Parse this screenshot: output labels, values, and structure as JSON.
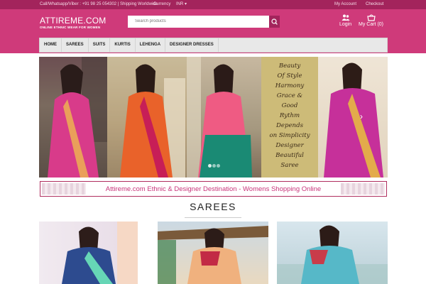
{
  "topbar": {
    "contact": "Call/Whatsapp/Viber : +91 98 25 054302 | Shipping Worldwide",
    "currency_label": "Currency",
    "currency_value": "INR",
    "my_account": "My Account",
    "checkout": "Checkout"
  },
  "header": {
    "logo_name": "ATTIREME.COM",
    "logo_tagline": "ONLINE ETHNIC WEAR FOR WOMEN",
    "search_placeholder": "Search products",
    "login_label": "Login",
    "cart_label": "My Cart (0)"
  },
  "nav": {
    "items": [
      "HOME",
      "SAREES",
      "SUITS",
      "KURTIS",
      "LEHENGA",
      "DESIGNER DRESSES"
    ]
  },
  "banner": {
    "quote_lines": [
      "Beauty",
      "Of Style",
      "Harmony",
      "Grace &",
      "Good",
      "Rythm",
      "Depends",
      "on Simplicity",
      "Designer",
      "Beautiful",
      "Saree"
    ],
    "slide_count": 3,
    "active_slide": 1
  },
  "tagline": "Attireme.com Ethnic & Designer Destination - Womens Shopping Online",
  "section": {
    "title": "SAREES"
  },
  "colors": {
    "brand_dark": "#a3245c",
    "brand": "#cf3a7a",
    "accent_text": "#c8347a"
  },
  "icons": [
    "search-icon",
    "user-icon",
    "cart-icon",
    "chevron-down-icon",
    "chevron-right-icon"
  ]
}
